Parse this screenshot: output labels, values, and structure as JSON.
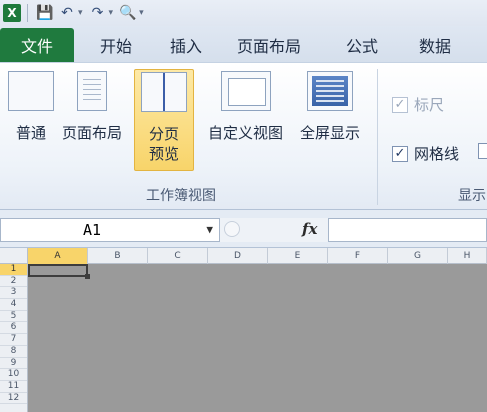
{
  "qat": {
    "logo": "X",
    "icons": [
      "save-icon",
      "undo-icon",
      "redo-icon",
      "print-preview-icon"
    ]
  },
  "tabs": [
    "文件",
    "开始",
    "插入",
    "页面布局",
    "公式",
    "数据"
  ],
  "ribbon": {
    "workbook_views": {
      "buttons": [
        {
          "label": "普通"
        },
        {
          "label": "页面布局"
        },
        {
          "label": "分页\n预览",
          "label_line1": "分页",
          "label_line2": "预览",
          "active": true
        },
        {
          "label": "自定义视图"
        },
        {
          "label": "全屏显示"
        }
      ],
      "group_label": "工作簿视图"
    },
    "show": {
      "checkboxes": [
        {
          "label": "标尺",
          "checked": true,
          "enabled": false
        },
        {
          "label": "网格线",
          "checked": true,
          "enabled": true
        }
      ],
      "group_label": "显示"
    }
  },
  "formula_bar": {
    "name_box": "A1",
    "fx": "fx",
    "formula": ""
  },
  "sheet": {
    "columns": [
      "A",
      "B",
      "C",
      "D",
      "E",
      "F",
      "G",
      "H"
    ],
    "rows": [
      "1",
      "2",
      "3",
      "4",
      "5",
      "6",
      "7",
      "8",
      "9",
      "10",
      "11",
      "12"
    ],
    "active_cell": "A1"
  },
  "colors": {
    "file_tab": "#1f7a3e",
    "active_button": "#f8d46a",
    "page_break_background": "#9a9a9a"
  }
}
